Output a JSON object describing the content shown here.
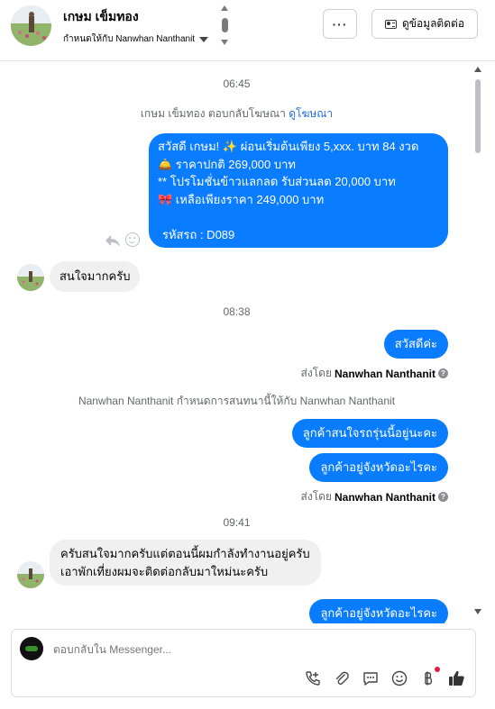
{
  "header": {
    "name": "เกษม เข็มทอง",
    "assigned": "กำหนดให้กับ Nanwhan Nanthanit",
    "contact_button": "ดูข้อมูลติดต่อ",
    "more_button": "···"
  },
  "chat": {
    "time1": "06:45",
    "ad_reply_prefix": "เกษม เข็มทอง ตอบกลับโฆษณา",
    "ad_reply_link": "ดูโฆษณา",
    "promo_lines": [
      "สวัสดี เกษม! ✨  ผ่อนเริ่มต้นเพียง 5,xxx. บาท 84 งวด",
      "🛎️ ราคาปกติ 269,000 บาท",
      "** โปรโมชั่นข้าวแลกลด รับส่วนลด 20,000 บาท",
      "🎀  เหลือเพียงราคา 249,000 บาท",
      "",
      "รหัสรถ : D089"
    ],
    "in_msg1": "สนใจมากครับ",
    "time2": "08:38",
    "out_msg1": "สวัสดีค่ะ",
    "sent_by_prefix": "ส่งโดย",
    "sent_by_name": "Nanwhan Nanthanit",
    "assign_note": "Nanwhan Nanthanit กำหนดการสนทนานี้ให้กับ Nanwhan Nanthanit",
    "out_msg2": "ลูกค้าสนใจรถรุ่นนี้อยู่นะคะ",
    "out_msg3": "ลูกค้าอยู่จังหวัดอะไรคะ",
    "time3": "09:41",
    "in_msg2_line1": "ครับสนใจมากครับแต่ตอนนี้ผมกำลังทำงานอยู่ครับ",
    "in_msg2_line2": "เอาพักเที่ยงผมจะติดต่อกลับมาใหม่นะครับ",
    "out_msg4": "ลูกค้าอยู่จังหวัดอะไรคะ"
  },
  "composer": {
    "placeholder": "ตอบกลับใน Messenger..."
  },
  "colors": {
    "accent": "#0a7cff",
    "incoming_bubble": "#f0f0f0",
    "link": "#216fdb"
  },
  "icons": [
    "chevron-updown-icon",
    "more-icon",
    "contact-card-icon",
    "reply-icon",
    "reaction-icon",
    "info-icon",
    "call-add-icon",
    "attachment-icon",
    "saved-reply-icon",
    "emoji-icon",
    "baht-icon",
    "thumbs-up-icon"
  ]
}
